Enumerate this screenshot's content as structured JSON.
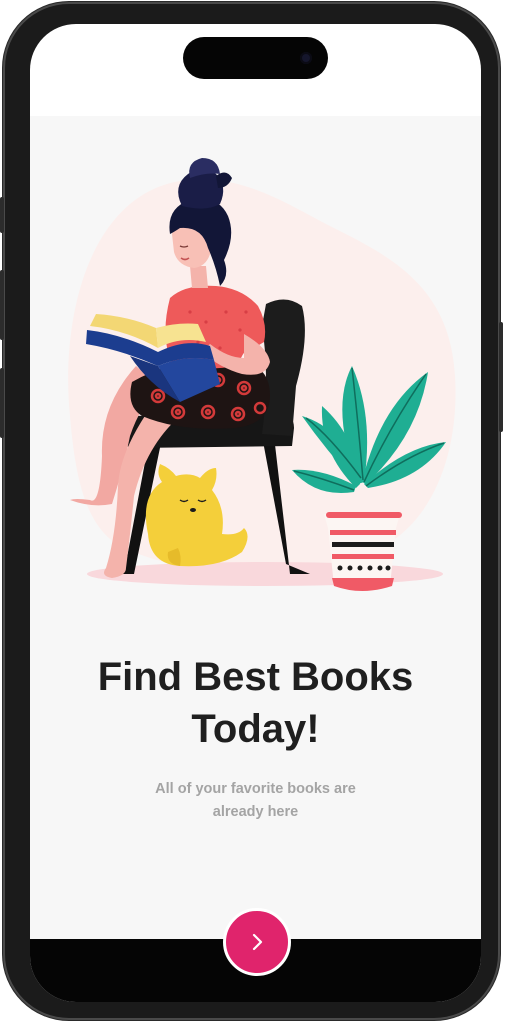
{
  "onboarding": {
    "title": "Find Best Books Today!",
    "subtitle": "All of your favorite books are already here",
    "next_icon": "chevron-right-icon"
  },
  "colors": {
    "accent": "#e0246c",
    "background": "#f7f7f7",
    "title": "#1f1f1f",
    "subtitle": "#a4a4a4"
  }
}
